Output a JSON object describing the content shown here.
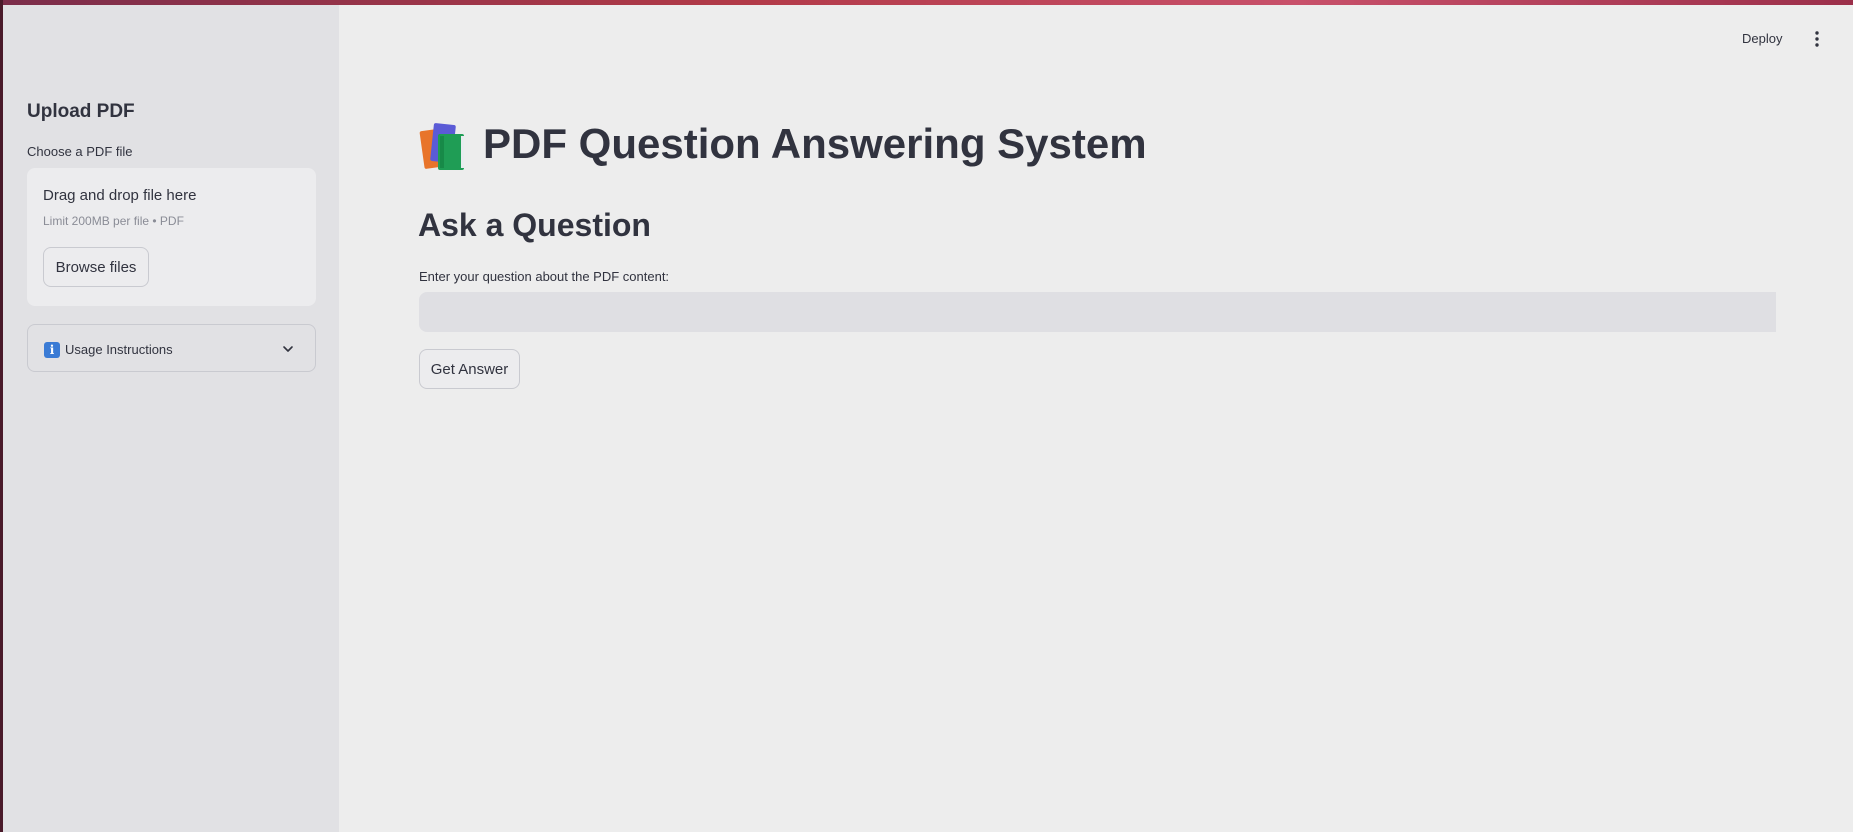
{
  "sidebar": {
    "title": "Upload PDF",
    "uploader_label": "Choose a PDF file",
    "dropzone_text": "Drag and drop file here",
    "dropzone_limit": "Limit 200MB per file • PDF",
    "browse_label": "Browse files",
    "expander_label": "Usage Instructions",
    "expander_icon": "info-icon"
  },
  "header": {
    "deploy_label": "Deploy",
    "menu_icon": "vertical-dots-icon"
  },
  "main": {
    "title_icon": "books-emoji-icon",
    "title": "PDF Question Answering System",
    "subheader": "Ask a Question",
    "question_label": "Enter your question about the PDF content:",
    "question_value": "",
    "question_placeholder": "",
    "submit_label": "Get Answer"
  },
  "colors": {
    "sidebar_bg": "#e1e1e4",
    "main_bg": "#ededed",
    "text": "#31333f",
    "top_strip": "#b23a48"
  }
}
